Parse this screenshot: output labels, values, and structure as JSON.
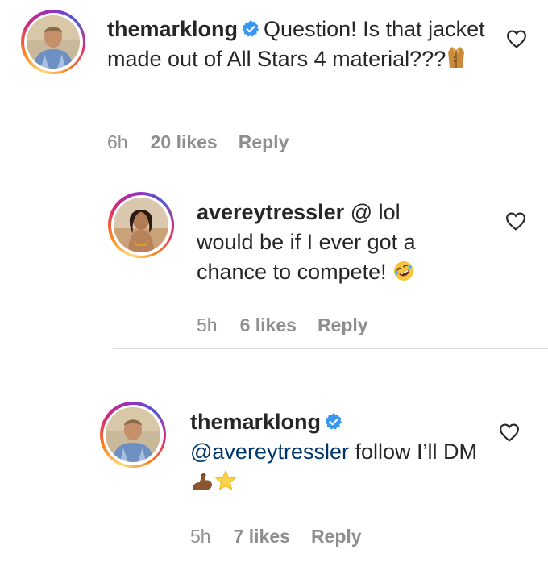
{
  "comments": [
    {
      "username": "themarklong",
      "verified": true,
      "text_parts": [
        "Question! Is that jacket made out of All Stars 4 material???"
      ],
      "emoji": "coat-emoji",
      "time": "6h",
      "likes": "20 likes",
      "reply": "Reply"
    },
    {
      "username": "avereytressler",
      "verified": false,
      "text_parts": [
        "@ lol would be if I ever got a chance to compete!"
      ],
      "emoji": "rolling-laughing-emoji",
      "time": "5h",
      "likes": "6 likes",
      "reply": "Reply"
    },
    {
      "username": "themarklong",
      "verified": true,
      "mention": "@avereytressler",
      "text_parts": [
        " follow I’ll DM"
      ],
      "emoji": "flexed-biceps-star-emoji",
      "time": "5h",
      "likes": "7 likes",
      "reply": "Reply"
    }
  ],
  "icons": {
    "like": "heart-outline-icon",
    "verified": "verified-badge-icon"
  },
  "colors": {
    "text": "#262626",
    "secondary": "#8e8e8e",
    "mention": "#00376b",
    "verified": "#3897f0",
    "divider": "#dbdbdb"
  }
}
